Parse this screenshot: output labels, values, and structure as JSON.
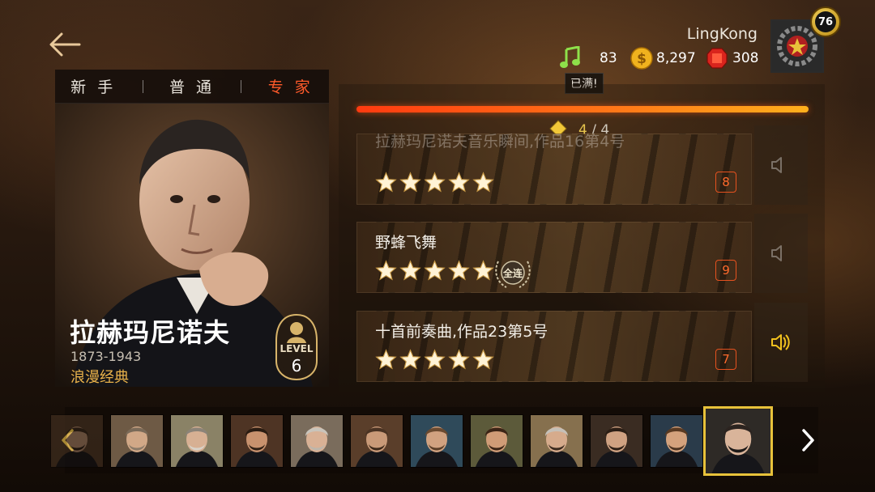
{
  "difficulty_tabs": [
    {
      "label": "新 手",
      "active": false
    },
    {
      "label": "普 通",
      "active": false
    },
    {
      "label": "专 家",
      "active": true
    }
  ],
  "user": {
    "name": "LingKong",
    "level": "76",
    "notes": "83",
    "notes_tip": "已满!",
    "coins": "8,297",
    "gems": "308"
  },
  "composer": {
    "name": "拉赫玛尼诺夫",
    "years": "1873-1943",
    "era": "浪漫经典",
    "level_label": "LEVEL",
    "level": "6"
  },
  "progress": {
    "current": "4",
    "separator": " / ",
    "total": "4",
    "fraction": 1.0
  },
  "songs": [
    {
      "title": "拉赫玛尼诺夫音乐瞬间,作品16第4号",
      "stars": 5,
      "full_combo": false,
      "difficulty": "8",
      "sound_active": false
    },
    {
      "title": "野蜂飞舞",
      "stars": 5,
      "full_combo": true,
      "full_combo_label": "全连",
      "difficulty": "9",
      "sound_active": false
    },
    {
      "title": "十首前奏曲,作品23第5号",
      "stars": 5,
      "full_combo": false,
      "difficulty": "7",
      "sound_active": true
    }
  ],
  "carousel": {
    "composers": [
      {
        "hair": "#3a2a1e",
        "beard": "#2b1f16",
        "skin": "#c99b7a",
        "bg": "#59402c"
      },
      {
        "hair": "#7a6a58",
        "beard": "#8a7a68",
        "skin": "#d1a887",
        "bg": "#6e5a45"
      },
      {
        "hair": "#8b8378",
        "beard": "#d8d2c8",
        "skin": "#d7b093",
        "bg": "#8a8266"
      },
      {
        "hair": "#2a1c12",
        "beard": "#2e1f14",
        "skin": "#c8926e",
        "bg": "#4e3424"
      },
      {
        "hair": "#c9c4bb",
        "beard": "#bdb6ab",
        "skin": "#d9b195",
        "bg": "#7a6c5c"
      },
      {
        "hair": "#4a3323",
        "beard": "#3b2819",
        "skin": "#c99a78",
        "bg": "#5a3e2a"
      },
      {
        "hair": "#6b4a30",
        "beard": "#5a3e27",
        "skin": "#d1a280",
        "bg": "#2f4a5a"
      },
      {
        "hair": "#3b2416",
        "beard": "#3b2416",
        "skin": "#d09c77",
        "bg": "#5c5a3a"
      },
      {
        "hair": "#c5c0b8",
        "beard": "#3a2a1e",
        "skin": "#d6ab8c",
        "bg": "#86704e"
      },
      {
        "hair": "#2b1e15",
        "beard": "#2b1e15",
        "skin": "#cfa282",
        "bg": "#3a2c22"
      },
      {
        "hair": "#5a3a22",
        "beard": "#4a3220",
        "skin": "#d4a27d",
        "bg": "#2a3b4a"
      },
      {
        "hair": "#2c2420",
        "beard": "#1e1a18",
        "skin": "#d9b49a",
        "bg": "#2e2a26"
      }
    ],
    "selected_index": 11
  },
  "colors": {
    "accent_orange": "#ff5a2a",
    "gold": "#e8c23a",
    "star": "#fff3d6"
  },
  "icons": {
    "back": "back-arrow-icon",
    "note": "music-note-icon",
    "coin": "coin-icon",
    "gem": "ruby-icon",
    "sound": "speaker-icon",
    "prev": "chevron-left-icon",
    "next": "chevron-right-icon"
  }
}
